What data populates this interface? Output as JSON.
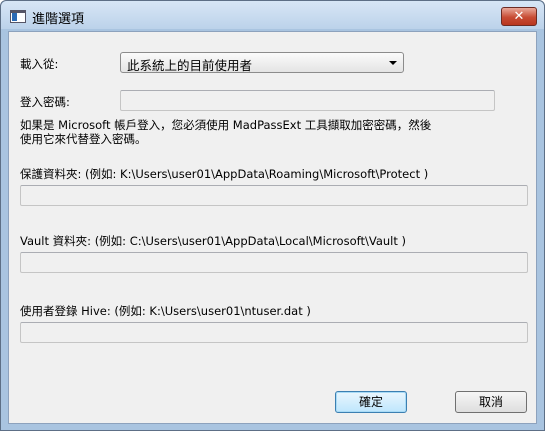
{
  "window": {
    "title": "進階選項",
    "close_glyph": "✕"
  },
  "load_from": {
    "label": "載入從:",
    "selected": "此系統上的目前使用者"
  },
  "password": {
    "label": "登入密碼:",
    "value": "",
    "note_line1": "如果是 Microsoft 帳戶登入，您必須使用 MadPassExt 工具擷取加密密碼，然後",
    "note_line2": "使用它來代替登入密碼。"
  },
  "protect_folder": {
    "label": "保護資料夾: (例如: K:\\Users\\user01\\AppData\\Roaming\\Microsoft\\Protect )",
    "value": ""
  },
  "vault_folder": {
    "label": "Vault 資料夾: (例如: C:\\Users\\user01\\AppData\\Local\\Microsoft\\Vault )",
    "value": ""
  },
  "registry_hive": {
    "label": "使用者登錄 Hive: (例如: K:\\Users\\user01\\ntuser.dat )",
    "value": ""
  },
  "buttons": {
    "ok": "確定",
    "cancel": "取消"
  }
}
